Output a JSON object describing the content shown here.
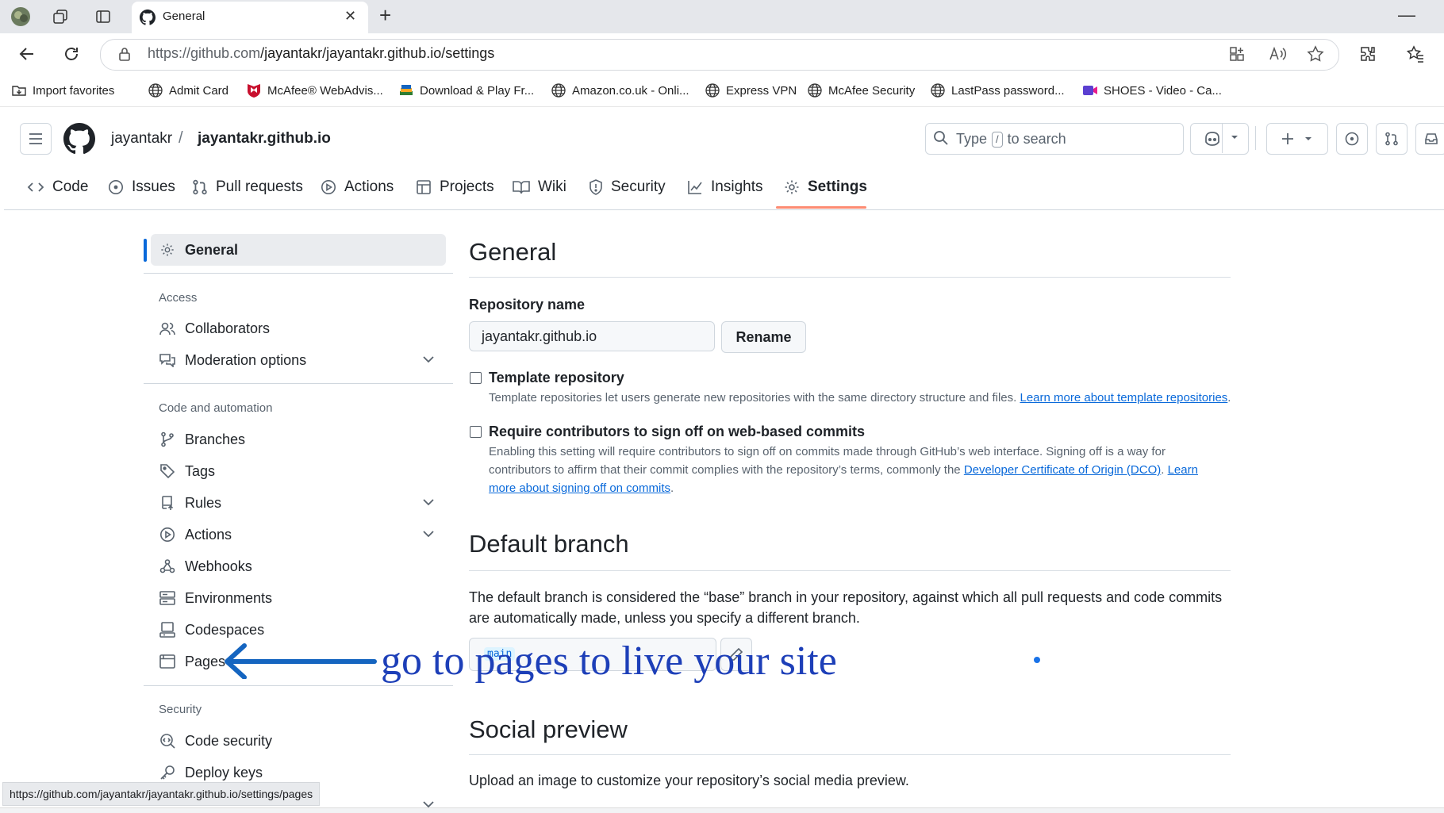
{
  "browser": {
    "tab_title": "General",
    "url_host": "https://github.com",
    "url_path": "/jayantakr/jayantakr.github.io/settings",
    "status_url": "https://github.com/jayantakr/jayantakr.github.io/settings/pages"
  },
  "bookmarks": [
    {
      "label": "Import favorites",
      "icon": "folder-import-icon"
    },
    {
      "label": "Admit Card",
      "icon": "globe-icon"
    },
    {
      "label": "McAfee® WebAdvis...",
      "icon": "mcafee-icon"
    },
    {
      "label": "Download & Play Fr...",
      "icon": "bluestacks-icon"
    },
    {
      "label": "Amazon.co.uk - Onli...",
      "icon": "globe-icon"
    },
    {
      "label": "Express VPN",
      "icon": "globe-icon"
    },
    {
      "label": "McAfee Security",
      "icon": "globe-icon"
    },
    {
      "label": "LastPass password...",
      "icon": "globe-icon"
    },
    {
      "label": "SHOES - Video - Ca...",
      "icon": "video-icon"
    }
  ],
  "header": {
    "owner": "jayantakr",
    "separator": "/",
    "repo": "jayantakr.github.io",
    "search_prefix": "Type",
    "search_key": "/",
    "search_suffix": "to search"
  },
  "nav_tabs": [
    {
      "label": "Code",
      "icon": "code-icon"
    },
    {
      "label": "Issues",
      "icon": "issue-icon"
    },
    {
      "label": "Pull requests",
      "icon": "pull-request-icon"
    },
    {
      "label": "Actions",
      "icon": "play-icon"
    },
    {
      "label": "Projects",
      "icon": "table-icon"
    },
    {
      "label": "Wiki",
      "icon": "book-icon"
    },
    {
      "label": "Security",
      "icon": "shield-icon"
    },
    {
      "label": "Insights",
      "icon": "graph-icon"
    },
    {
      "label": "Settings",
      "icon": "gear-icon",
      "active": true
    }
  ],
  "sidebar": {
    "general": "General",
    "access_heading": "Access",
    "collaborators": "Collaborators",
    "moderation": "Moderation options",
    "code_heading": "Code and automation",
    "branches": "Branches",
    "tags": "Tags",
    "rules": "Rules",
    "actions": "Actions",
    "webhooks": "Webhooks",
    "environments": "Environments",
    "codespaces": "Codespaces",
    "pages": "Pages",
    "security_heading": "Security",
    "code_security": "Code security",
    "deploy_keys": "Deploy keys"
  },
  "main": {
    "title": "General",
    "repo_name_label": "Repository name",
    "repo_name_value": "jayantakr.github.io",
    "rename_button": "Rename",
    "template_title": "Template repository",
    "template_desc": "Template repositories let users generate new repositories with the same directory structure and files.",
    "template_link": "Learn more about template repositories",
    "signoff_title": "Require contributors to sign off on web-based commits",
    "signoff_desc_1": "Enabling this setting will require contributors to sign off on commits made through GitHub’s web interface. Signing off is a way for contributors to affirm that their commit complies with the repository’s terms, commonly the",
    "signoff_link_1": "Developer Certificate of Origin (DCO)",
    "signoff_link_2": "Learn more about signing off on commits",
    "default_branch_title": "Default branch",
    "default_branch_desc": "The default branch is considered the “base” branch in your repository, against which all pull requests and code commits are automatically made, unless you specify a different branch.",
    "branch_name": "main",
    "social_title": "Social preview",
    "social_desc": "Upload an image to customize your repository’s social media preview."
  },
  "annotation": {
    "text": "go to pages to live your site",
    "color": "#1d3fb8"
  },
  "colors": {
    "accent": "#0969da",
    "active_tab_underline": "#fd8c73"
  }
}
